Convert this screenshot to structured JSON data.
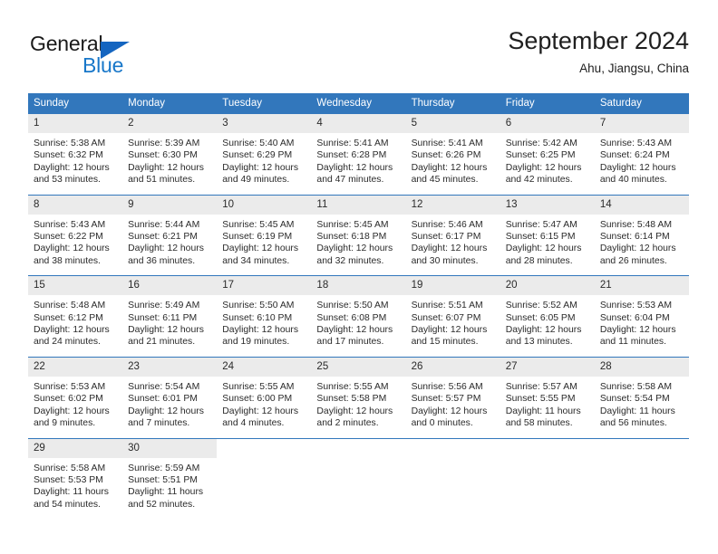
{
  "brand": {
    "name_top": "General",
    "name_bottom": "Blue",
    "triangle_color": "#1565c0",
    "blue_text_color": "#1877c9"
  },
  "header": {
    "title": "September 2024",
    "subtitle": "Ahu, Jiangsu, China"
  },
  "colors": {
    "header_blue": "#3277bc",
    "daynum_gray": "#ebebeb",
    "text": "#2a2a2a"
  },
  "weekdays": [
    "Sunday",
    "Monday",
    "Tuesday",
    "Wednesday",
    "Thursday",
    "Friday",
    "Saturday"
  ],
  "weeks": [
    [
      {
        "day": "1",
        "sunrise": "Sunrise: 5:38 AM",
        "sunset": "Sunset: 6:32 PM",
        "daylight1": "Daylight: 12 hours",
        "daylight2": "and 53 minutes."
      },
      {
        "day": "2",
        "sunrise": "Sunrise: 5:39 AM",
        "sunset": "Sunset: 6:30 PM",
        "daylight1": "Daylight: 12 hours",
        "daylight2": "and 51 minutes."
      },
      {
        "day": "3",
        "sunrise": "Sunrise: 5:40 AM",
        "sunset": "Sunset: 6:29 PM",
        "daylight1": "Daylight: 12 hours",
        "daylight2": "and 49 minutes."
      },
      {
        "day": "4",
        "sunrise": "Sunrise: 5:41 AM",
        "sunset": "Sunset: 6:28 PM",
        "daylight1": "Daylight: 12 hours",
        "daylight2": "and 47 minutes."
      },
      {
        "day": "5",
        "sunrise": "Sunrise: 5:41 AM",
        "sunset": "Sunset: 6:26 PM",
        "daylight1": "Daylight: 12 hours",
        "daylight2": "and 45 minutes."
      },
      {
        "day": "6",
        "sunrise": "Sunrise: 5:42 AM",
        "sunset": "Sunset: 6:25 PM",
        "daylight1": "Daylight: 12 hours",
        "daylight2": "and 42 minutes."
      },
      {
        "day": "7",
        "sunrise": "Sunrise: 5:43 AM",
        "sunset": "Sunset: 6:24 PM",
        "daylight1": "Daylight: 12 hours",
        "daylight2": "and 40 minutes."
      }
    ],
    [
      {
        "day": "8",
        "sunrise": "Sunrise: 5:43 AM",
        "sunset": "Sunset: 6:22 PM",
        "daylight1": "Daylight: 12 hours",
        "daylight2": "and 38 minutes."
      },
      {
        "day": "9",
        "sunrise": "Sunrise: 5:44 AM",
        "sunset": "Sunset: 6:21 PM",
        "daylight1": "Daylight: 12 hours",
        "daylight2": "and 36 minutes."
      },
      {
        "day": "10",
        "sunrise": "Sunrise: 5:45 AM",
        "sunset": "Sunset: 6:19 PM",
        "daylight1": "Daylight: 12 hours",
        "daylight2": "and 34 minutes."
      },
      {
        "day": "11",
        "sunrise": "Sunrise: 5:45 AM",
        "sunset": "Sunset: 6:18 PM",
        "daylight1": "Daylight: 12 hours",
        "daylight2": "and 32 minutes."
      },
      {
        "day": "12",
        "sunrise": "Sunrise: 5:46 AM",
        "sunset": "Sunset: 6:17 PM",
        "daylight1": "Daylight: 12 hours",
        "daylight2": "and 30 minutes."
      },
      {
        "day": "13",
        "sunrise": "Sunrise: 5:47 AM",
        "sunset": "Sunset: 6:15 PM",
        "daylight1": "Daylight: 12 hours",
        "daylight2": "and 28 minutes."
      },
      {
        "day": "14",
        "sunrise": "Sunrise: 5:48 AM",
        "sunset": "Sunset: 6:14 PM",
        "daylight1": "Daylight: 12 hours",
        "daylight2": "and 26 minutes."
      }
    ],
    [
      {
        "day": "15",
        "sunrise": "Sunrise: 5:48 AM",
        "sunset": "Sunset: 6:12 PM",
        "daylight1": "Daylight: 12 hours",
        "daylight2": "and 24 minutes."
      },
      {
        "day": "16",
        "sunrise": "Sunrise: 5:49 AM",
        "sunset": "Sunset: 6:11 PM",
        "daylight1": "Daylight: 12 hours",
        "daylight2": "and 21 minutes."
      },
      {
        "day": "17",
        "sunrise": "Sunrise: 5:50 AM",
        "sunset": "Sunset: 6:10 PM",
        "daylight1": "Daylight: 12 hours",
        "daylight2": "and 19 minutes."
      },
      {
        "day": "18",
        "sunrise": "Sunrise: 5:50 AM",
        "sunset": "Sunset: 6:08 PM",
        "daylight1": "Daylight: 12 hours",
        "daylight2": "and 17 minutes."
      },
      {
        "day": "19",
        "sunrise": "Sunrise: 5:51 AM",
        "sunset": "Sunset: 6:07 PM",
        "daylight1": "Daylight: 12 hours",
        "daylight2": "and 15 minutes."
      },
      {
        "day": "20",
        "sunrise": "Sunrise: 5:52 AM",
        "sunset": "Sunset: 6:05 PM",
        "daylight1": "Daylight: 12 hours",
        "daylight2": "and 13 minutes."
      },
      {
        "day": "21",
        "sunrise": "Sunrise: 5:53 AM",
        "sunset": "Sunset: 6:04 PM",
        "daylight1": "Daylight: 12 hours",
        "daylight2": "and 11 minutes."
      }
    ],
    [
      {
        "day": "22",
        "sunrise": "Sunrise: 5:53 AM",
        "sunset": "Sunset: 6:02 PM",
        "daylight1": "Daylight: 12 hours",
        "daylight2": "and 9 minutes."
      },
      {
        "day": "23",
        "sunrise": "Sunrise: 5:54 AM",
        "sunset": "Sunset: 6:01 PM",
        "daylight1": "Daylight: 12 hours",
        "daylight2": "and 7 minutes."
      },
      {
        "day": "24",
        "sunrise": "Sunrise: 5:55 AM",
        "sunset": "Sunset: 6:00 PM",
        "daylight1": "Daylight: 12 hours",
        "daylight2": "and 4 minutes."
      },
      {
        "day": "25",
        "sunrise": "Sunrise: 5:55 AM",
        "sunset": "Sunset: 5:58 PM",
        "daylight1": "Daylight: 12 hours",
        "daylight2": "and 2 minutes."
      },
      {
        "day": "26",
        "sunrise": "Sunrise: 5:56 AM",
        "sunset": "Sunset: 5:57 PM",
        "daylight1": "Daylight: 12 hours",
        "daylight2": "and 0 minutes."
      },
      {
        "day": "27",
        "sunrise": "Sunrise: 5:57 AM",
        "sunset": "Sunset: 5:55 PM",
        "daylight1": "Daylight: 11 hours",
        "daylight2": "and 58 minutes."
      },
      {
        "day": "28",
        "sunrise": "Sunrise: 5:58 AM",
        "sunset": "Sunset: 5:54 PM",
        "daylight1": "Daylight: 11 hours",
        "daylight2": "and 56 minutes."
      }
    ],
    [
      {
        "day": "29",
        "sunrise": "Sunrise: 5:58 AM",
        "sunset": "Sunset: 5:53 PM",
        "daylight1": "Daylight: 11 hours",
        "daylight2": "and 54 minutes."
      },
      {
        "day": "30",
        "sunrise": "Sunrise: 5:59 AM",
        "sunset": "Sunset: 5:51 PM",
        "daylight1": "Daylight: 11 hours",
        "daylight2": "and 52 minutes."
      },
      {
        "day": "",
        "sunrise": "",
        "sunset": "",
        "daylight1": "",
        "daylight2": ""
      },
      {
        "day": "",
        "sunrise": "",
        "sunset": "",
        "daylight1": "",
        "daylight2": ""
      },
      {
        "day": "",
        "sunrise": "",
        "sunset": "",
        "daylight1": "",
        "daylight2": ""
      },
      {
        "day": "",
        "sunrise": "",
        "sunset": "",
        "daylight1": "",
        "daylight2": ""
      },
      {
        "day": "",
        "sunrise": "",
        "sunset": "",
        "daylight1": "",
        "daylight2": ""
      }
    ]
  ]
}
